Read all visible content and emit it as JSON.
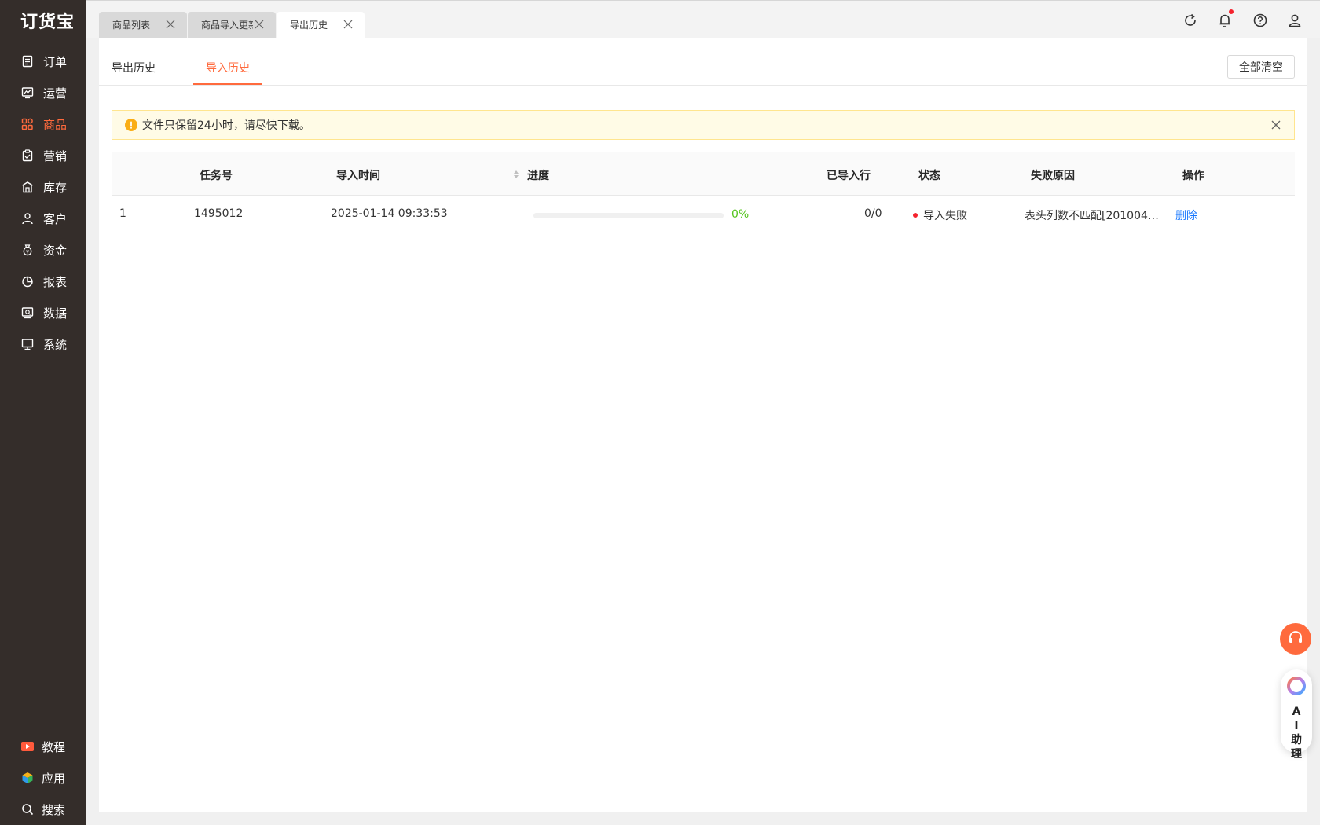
{
  "app": {
    "logo": "订货宝"
  },
  "sidebar": {
    "items": [
      {
        "label": "订单",
        "icon": "order-icon"
      },
      {
        "label": "运营",
        "icon": "operation-icon"
      },
      {
        "label": "商品",
        "icon": "product-icon",
        "active": true
      },
      {
        "label": "营销",
        "icon": "marketing-icon"
      },
      {
        "label": "库存",
        "icon": "warehouse-icon"
      },
      {
        "label": "客户",
        "icon": "customer-icon"
      },
      {
        "label": "资金",
        "icon": "money-bag-icon"
      },
      {
        "label": "报表",
        "icon": "pie-chart-icon"
      },
      {
        "label": "数据",
        "icon": "data-icon"
      },
      {
        "label": "系统",
        "icon": "monitor-icon"
      }
    ],
    "bottom": [
      {
        "label": "教程",
        "icon": "video-icon"
      },
      {
        "label": "应用",
        "icon": "cube-icon"
      },
      {
        "label": "搜索",
        "icon": "search-icon"
      }
    ]
  },
  "tabs": [
    {
      "label": "商品列表"
    },
    {
      "label": "商品导入更新"
    },
    {
      "label": "导出历史",
      "active": true
    }
  ],
  "subtabs": {
    "export": "导出历史",
    "import": "导入历史",
    "active": "import"
  },
  "toolbar": {
    "clear_all": "全部清空"
  },
  "alert": {
    "message": "文件只保留24小时，请尽快下载。"
  },
  "table": {
    "headers": {
      "task_no": "任务号",
      "import_time": "导入时间",
      "progress": "进度",
      "imported_rows": "已导入行",
      "status": "状态",
      "fail_reason": "失败原因",
      "action": "操作"
    },
    "rows": [
      {
        "index": "1",
        "task_no": "1495012",
        "import_time": "2025-01-14 09:33:53",
        "progress": 0,
        "progress_text": "0%",
        "imported_rows": "0/0",
        "status": "导入失败",
        "fail_reason": "表头列数不匹配[2010040...",
        "action": "删除"
      }
    ]
  },
  "widgets": {
    "ai_assistant": "AI助理"
  },
  "colors": {
    "accent": "#ff6a3d",
    "sidebar_bg": "#342d2a",
    "success": "#52c41a",
    "error": "#f5222d",
    "link": "#1677ff"
  }
}
